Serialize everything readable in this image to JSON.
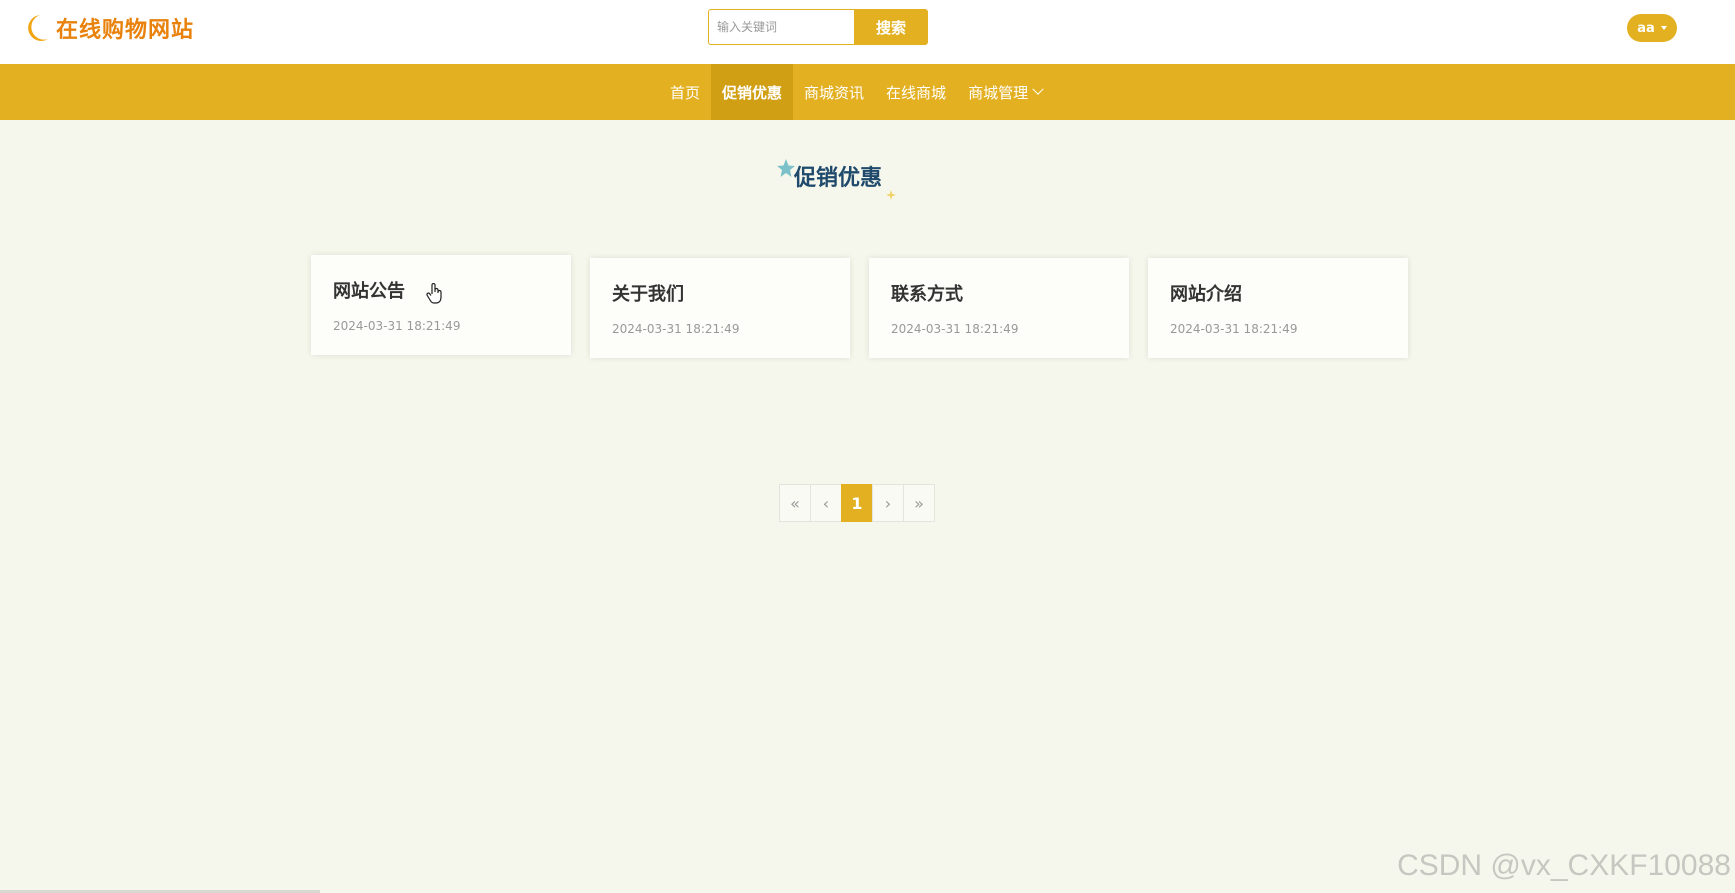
{
  "header": {
    "site_title": "在线购物网站",
    "search_placeholder": "输入关键词",
    "search_button": "搜索",
    "user_name": "aa"
  },
  "nav": {
    "items": [
      {
        "label": "首页"
      },
      {
        "label": "促销优惠"
      },
      {
        "label": "商城资讯"
      },
      {
        "label": "在线商城"
      },
      {
        "label": "商城管理"
      }
    ],
    "active_index": 1
  },
  "section": {
    "title": "促销优惠"
  },
  "cards": [
    {
      "title": "网站公告",
      "date": "2024-03-31 18:21:49"
    },
    {
      "title": "关于我们",
      "date": "2024-03-31 18:21:49"
    },
    {
      "title": "联系方式",
      "date": "2024-03-31 18:21:49"
    },
    {
      "title": "网站介绍",
      "date": "2024-03-31 18:21:49"
    }
  ],
  "pagination": {
    "first": "«",
    "prev": "‹",
    "current": "1",
    "next": "›",
    "last": "»"
  },
  "watermark": "CSDN @vx_CXKF10088",
  "colors": {
    "accent": "#e3b022",
    "nav_active": "#d19f14",
    "background": "#f6f7ec",
    "title_blue": "#1f4a6b",
    "logo_orange": "#e8820c"
  }
}
